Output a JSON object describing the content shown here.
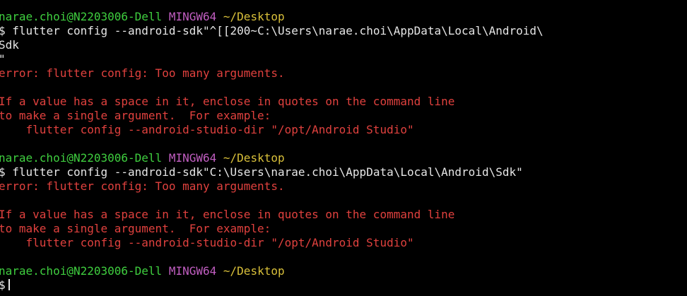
{
  "prompt": {
    "user_host": "narae.choi@N2203006-Dell",
    "shell": "MINGW64",
    "cwd": "~/Desktop",
    "symbol": "$"
  },
  "session1": {
    "command_line1": "flutter config --android-sdk\"^[[200~C:\\Users\\narae.choi\\AppData\\Local\\Android\\",
    "command_line2": "Sdk",
    "command_line3": "\"",
    "error": "error: flutter config: Too many arguments.",
    "help1": "If a value has a space in it, enclose in quotes on the command line",
    "help2": "to make a single argument.  For example:",
    "example": "    flutter config --android-studio-dir \"/opt/Android Studio\""
  },
  "session2": {
    "command": "flutter config --android-sdk\"C:\\Users\\narae.choi\\AppData\\Local\\Android\\Sdk\"",
    "error": "error: flutter config: Too many arguments.",
    "help1": "If a value has a space in it, enclose in quotes on the command line",
    "help2": "to make a single argument.  For example:",
    "example": "    flutter config --android-studio-dir \"/opt/Android Studio\""
  },
  "colors": {
    "background": "#000000",
    "prompt_user": "#3fcf3f",
    "prompt_shell": "#c15ec1",
    "prompt_path": "#d9c03a",
    "error": "#e0413e",
    "text": "#e6e6e6"
  }
}
